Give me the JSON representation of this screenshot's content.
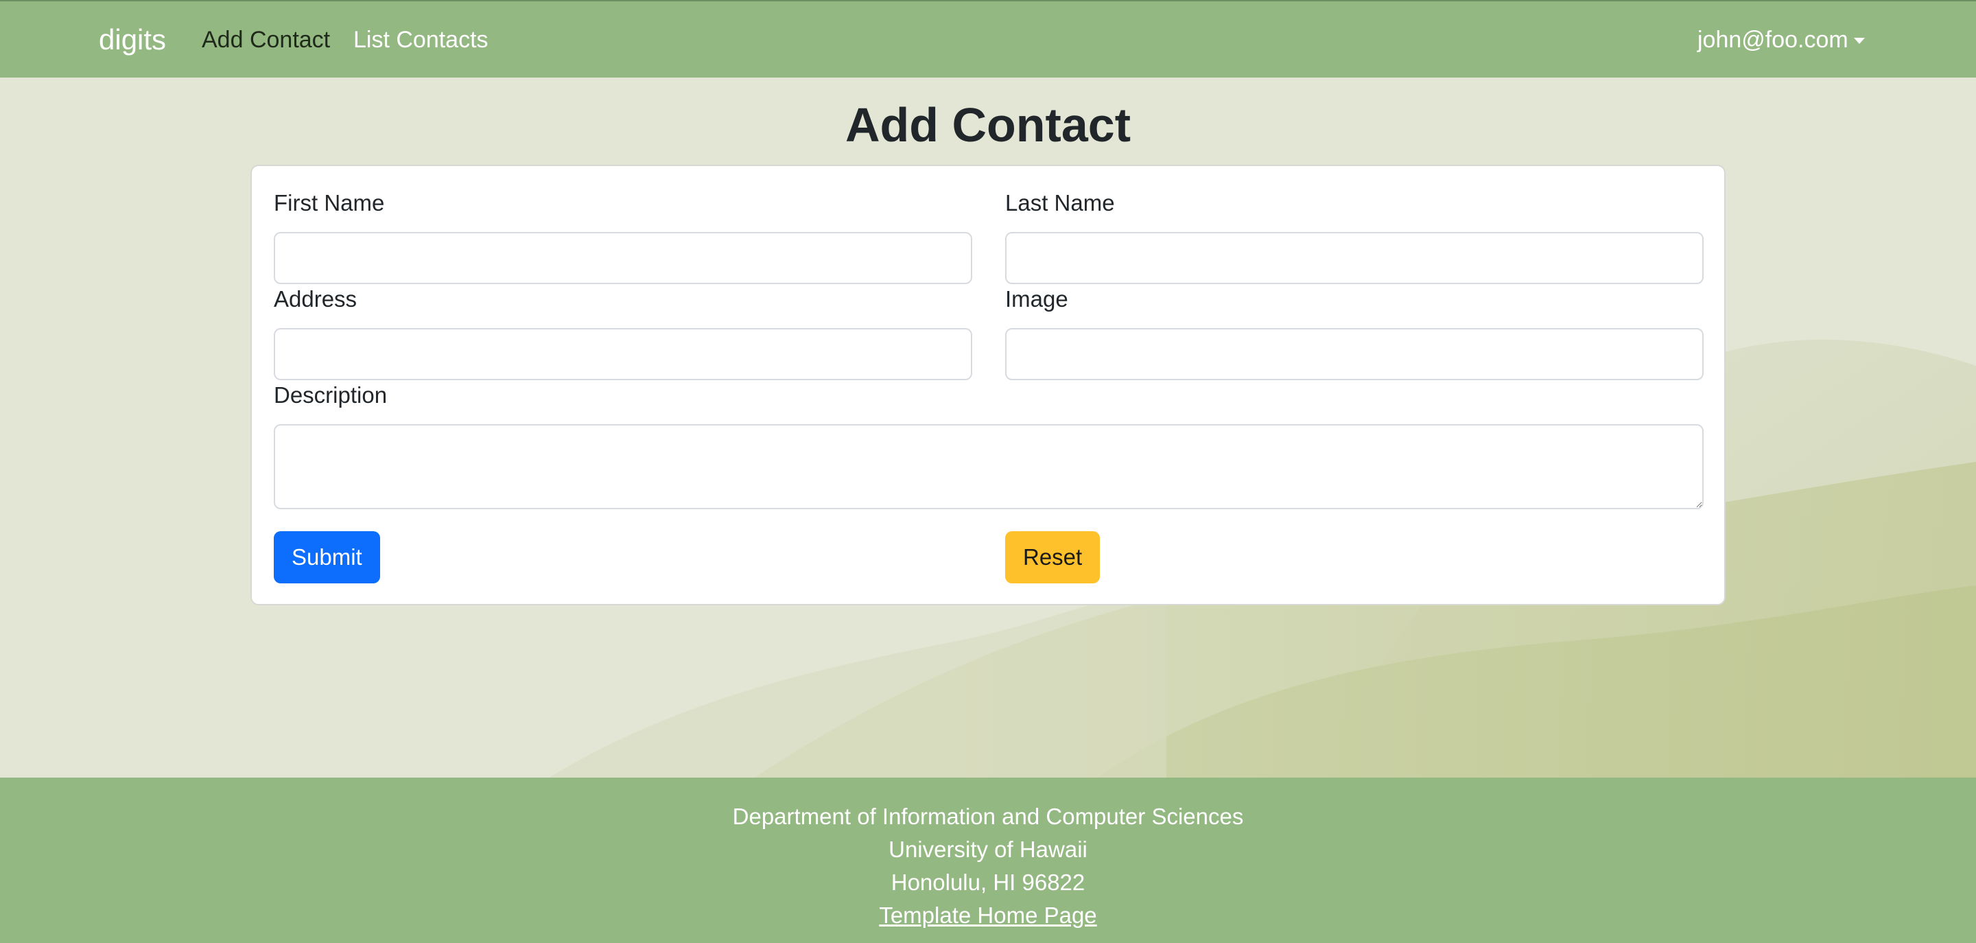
{
  "navbar": {
    "brand": "digits",
    "links": [
      {
        "label": "Add Contact",
        "active": true
      },
      {
        "label": "List Contacts",
        "active": false
      }
    ],
    "user": "john@foo.com"
  },
  "page": {
    "title": "Add Contact"
  },
  "form": {
    "first_name": {
      "label": "First Name",
      "value": ""
    },
    "last_name": {
      "label": "Last Name",
      "value": ""
    },
    "address": {
      "label": "Address",
      "value": ""
    },
    "image": {
      "label": "Image",
      "value": ""
    },
    "description": {
      "label": "Description",
      "value": ""
    },
    "submit_label": "Submit",
    "reset_label": "Reset"
  },
  "footer": {
    "lines": [
      "Department of Information and Computer Sciences",
      "University of Hawaii",
      "Honolulu, HI 96822"
    ],
    "link_label": "Template Home Page"
  },
  "colors": {
    "navbar_bg": "#94b882",
    "page_bg": "#e3e6d5",
    "submit": "#0d6efd",
    "reset": "#ffc12b"
  }
}
